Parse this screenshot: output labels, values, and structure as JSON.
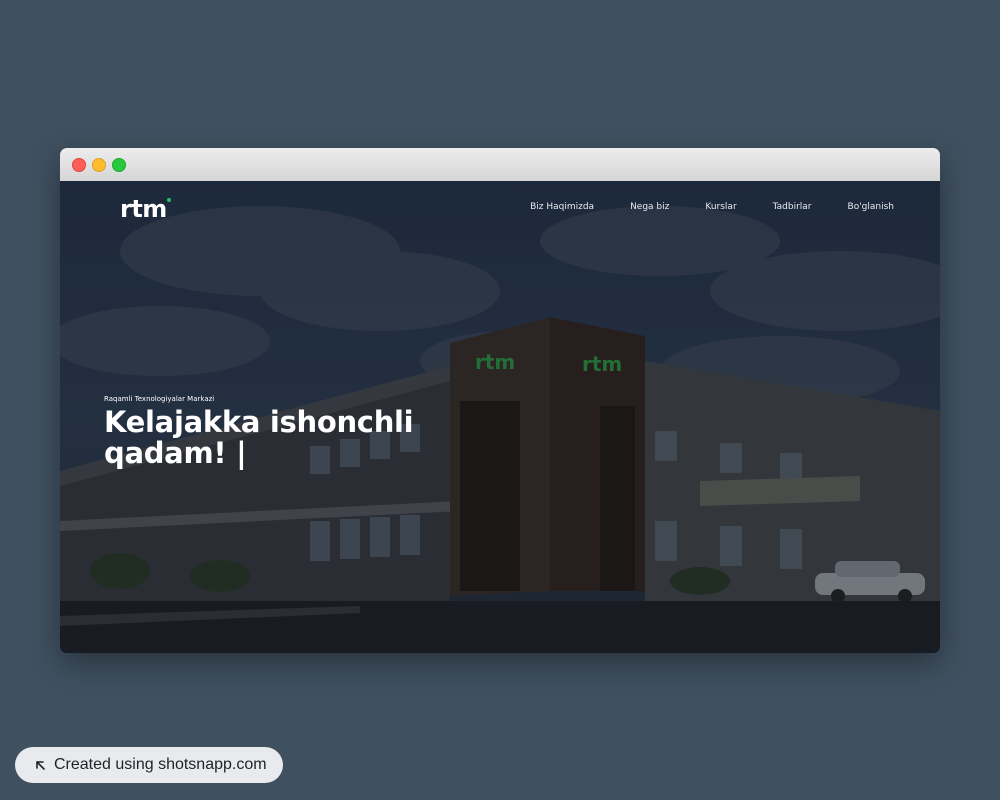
{
  "site": {
    "logo_text": "rtm",
    "nav": [
      {
        "label": "Biz Haqimizda"
      },
      {
        "label": "Nega biz"
      },
      {
        "label": "Kurslar"
      },
      {
        "label": "Tadbirlar"
      },
      {
        "label": "Bo'glanish"
      }
    ],
    "hero": {
      "subtitle": "Raqamli Texnologiyalar Markazi",
      "headline_line1": "Kelajakka ishonchli",
      "headline_line2": "qadam! |"
    }
  },
  "badge": {
    "text": "Created using shotsnapp.com",
    "icon": "arrow-up-left-icon"
  },
  "colors": {
    "background": "#3f5060",
    "accent": "#22c55e",
    "traffic_red": "#ff5f57",
    "traffic_yellow": "#febc2e",
    "traffic_green": "#28c840"
  }
}
